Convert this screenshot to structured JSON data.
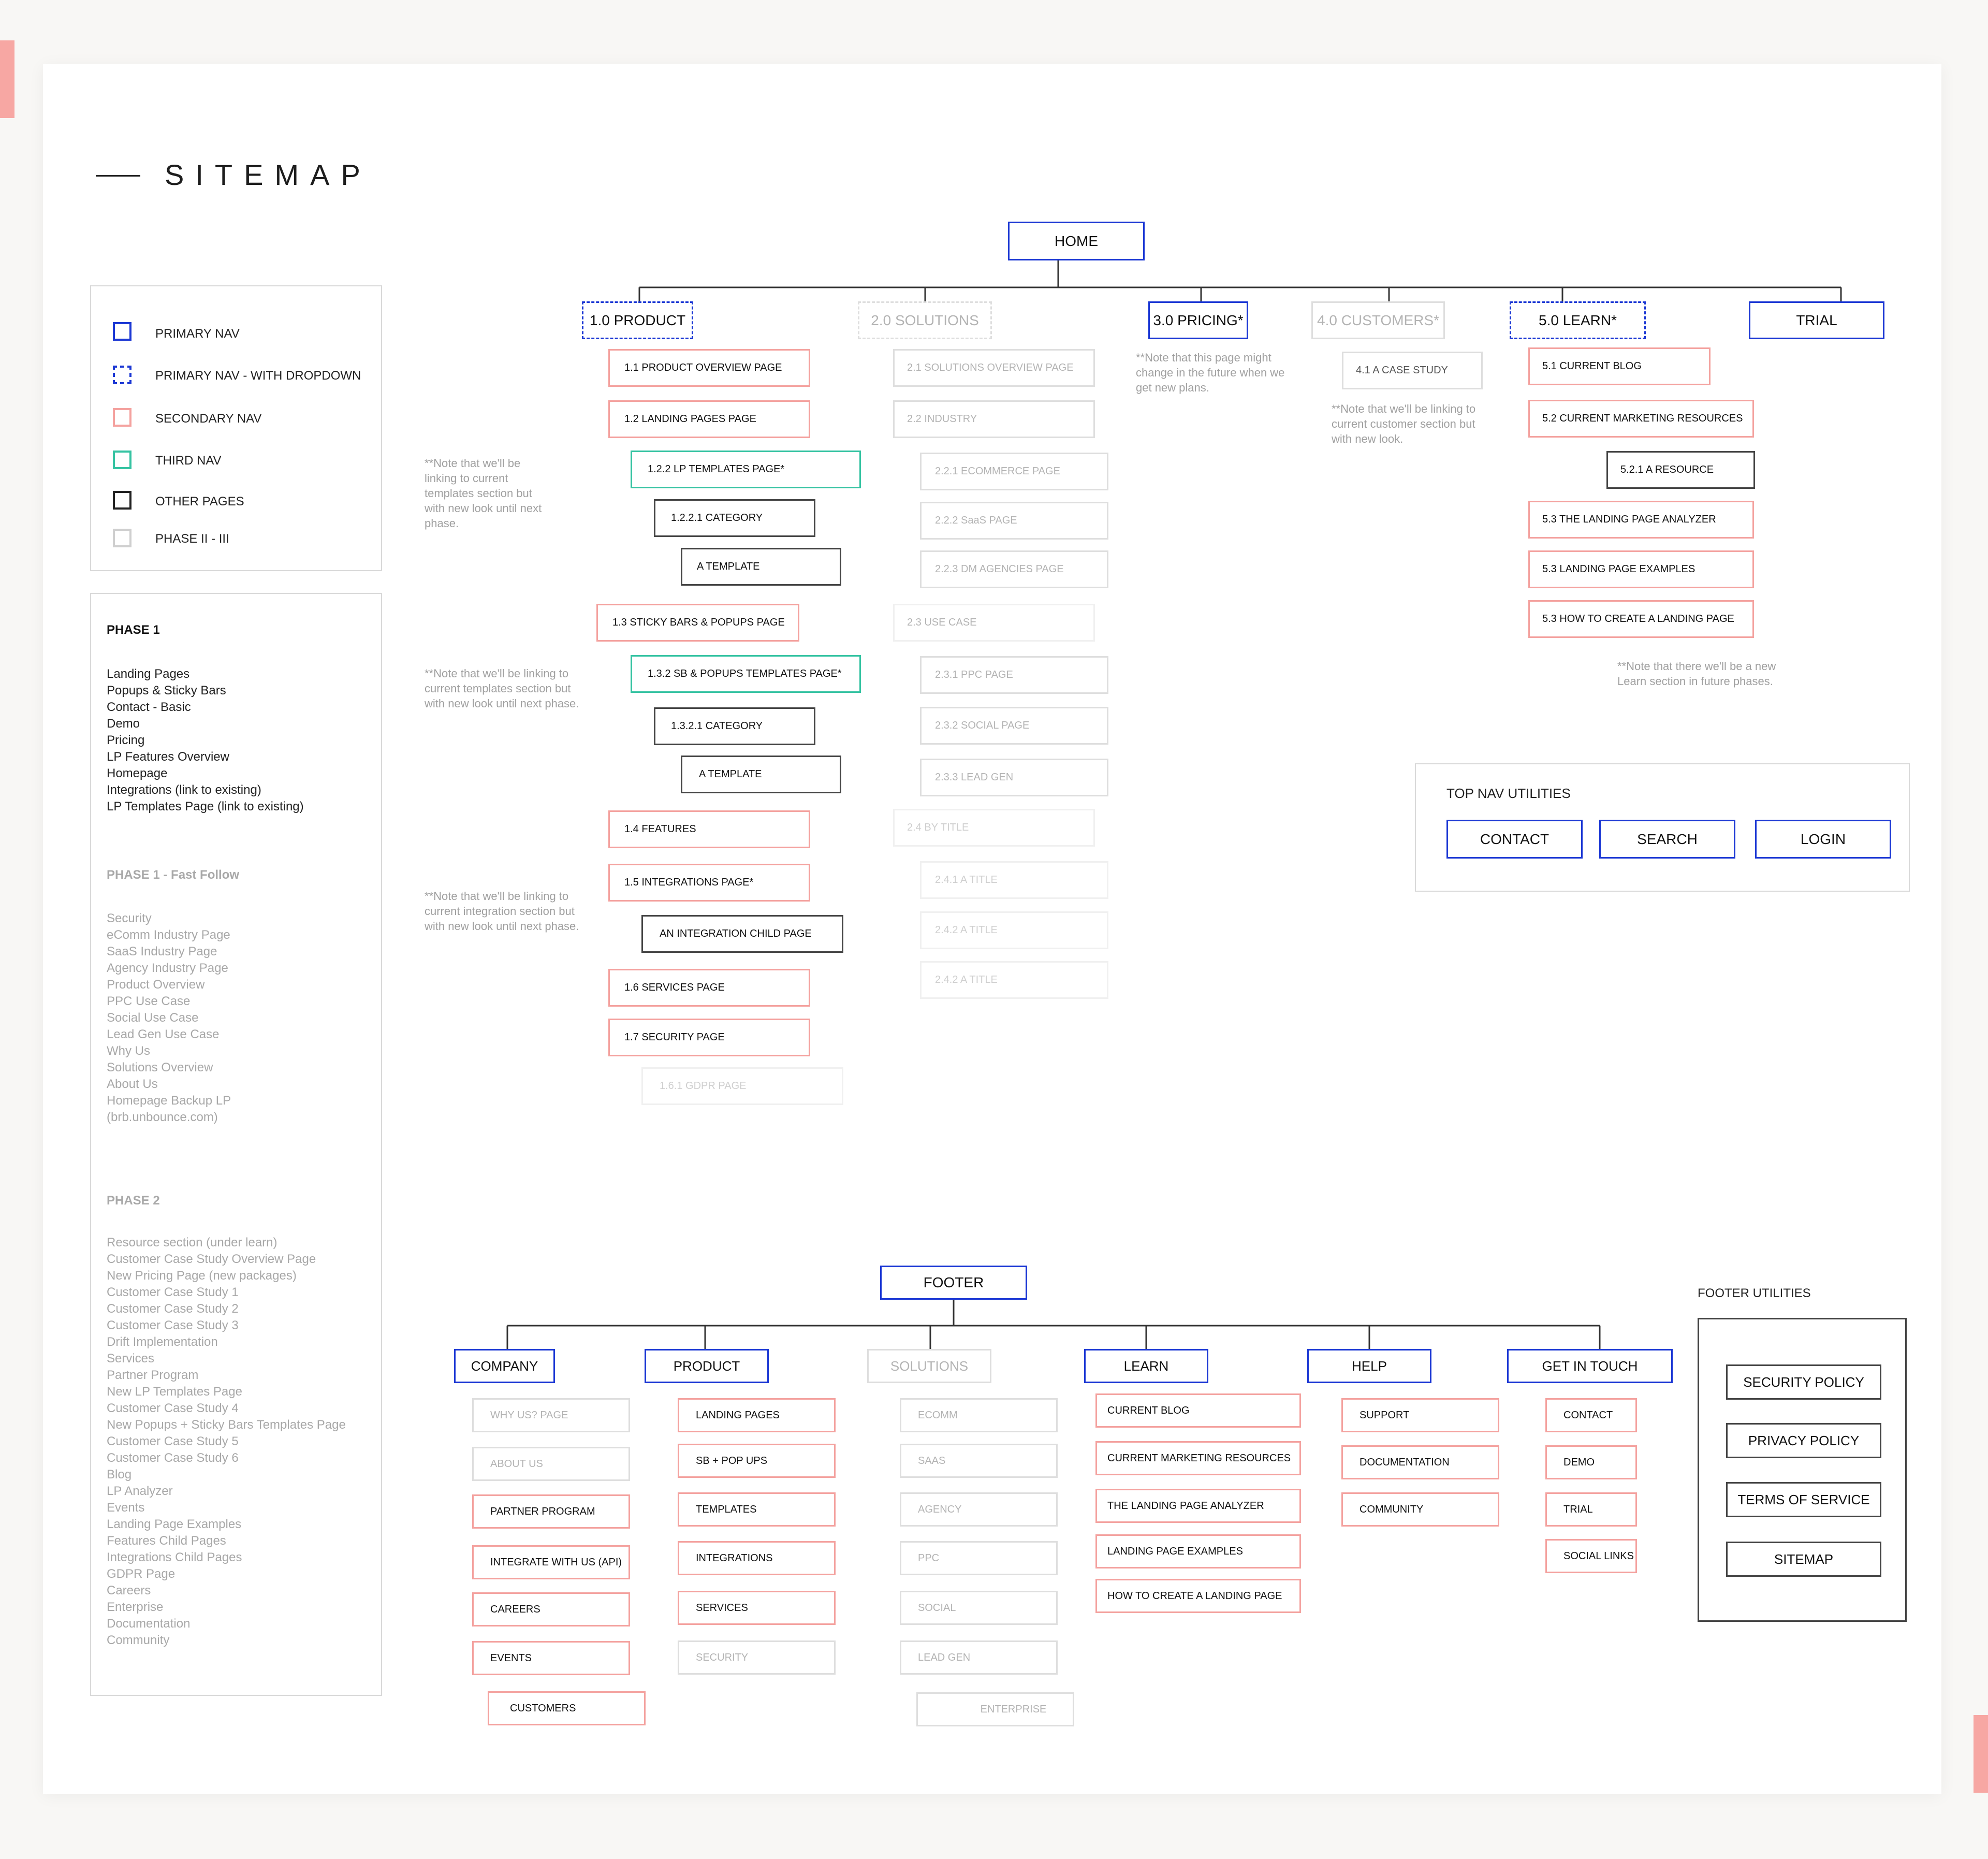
{
  "title": "SITEMAP",
  "legend": {
    "primary_nav": "PRIMARY NAV",
    "primary_nav_dropdown": "PRIMARY NAV - WITH DROPDOWN",
    "secondary_nav": "SECONDARY NAV",
    "third_nav": "THIRD NAV",
    "other_pages": "OTHER PAGES",
    "phase_2_3": "PHASE II - III"
  },
  "colors": {
    "primary": "#1c38d4",
    "secondary": "#f4a29f",
    "third": "#35c3a2",
    "other": "#444444",
    "phase": "#dedede"
  },
  "phases": {
    "phase1_title": "PHASE 1",
    "phase1_items": "Landing Pages\nPopups & Sticky Bars\nContact - Basic\nDemo\nPricing\nLP Features Overview\nHomepage\nIntegrations (link to existing)\nLP Templates Page (link to existing)",
    "phase1ff_title": "PHASE 1 - Fast Follow",
    "phase1ff_items": "Security\neComm Industry Page\nSaaS Industry Page\nAgency Industry Page\nProduct Overview\nPPC Use Case\nSocial Use Case\nLead Gen Use Case\nWhy Us\nSolutions Overview\nAbout Us\nHomepage Backup LP\n(brb.unbounce.com)",
    "phase2_title": "PHASE 2",
    "phase2_items": "Resource section (under learn)\nCustomer Case Study Overview Page\nNew Pricing Page (new packages)\nCustomer Case Study 1\nCustomer Case Study 2\nCustomer Case Study 3\nDrift Implementation\nServices\nPartner Program\nNew LP Templates Page\nCustomer Case Study 4\nNew Popups + Sticky Bars Templates Page\nCustomer Case Study 5\nCustomer Case Study 6\nBlog\nLP Analyzer\nEvents\nLanding Page Examples\nFeatures Child Pages\nIntegrations Child Pages\nGDPR Page\nCareers\nEnterprise\nDocumentation\nCommunity"
  },
  "top": {
    "home": "HOME",
    "nav": {
      "product": "1.0 PRODUCT",
      "solutions": "2.0 SOLUTIONS",
      "pricing": "3.0 PRICING*",
      "customers": "4.0 CUSTOMERS*",
      "learn": "5.0 LEARN*",
      "trial": "TRIAL"
    },
    "product": {
      "p1_1": "1.1  PRODUCT OVERVIEW PAGE",
      "p1_2": "1.2   LANDING PAGES PAGE",
      "p1_2_2": "1.2.2   LP TEMPLATES PAGE*",
      "p1_2_2_1": "1.2.2.1   CATEGORY",
      "p1_tmpl1": "A TEMPLATE",
      "p1_3": "1.3  STICKY BARS & POPUPS PAGE",
      "p1_3_2": "1.3.2   SB & POPUPS TEMPLATES PAGE*",
      "p1_3_2_1": "1.3.2.1   CATEGORY",
      "p1_tmpl2": "A TEMPLATE",
      "p1_4": "1.4  FEATURES",
      "p1_5": "1.5  INTEGRATIONS PAGE*",
      "p1_int_child": "AN INTEGRATION CHILD PAGE",
      "p1_6": "1.6 SERVICES PAGE",
      "p1_7": "1.7 SECURITY PAGE",
      "p1_6_1": "1.6.1 GDPR PAGE"
    },
    "solutions": {
      "s2_1": "2.1  SOLUTIONS OVERVIEW PAGE",
      "s2_2": "2.2  INDUSTRY",
      "s2_2_1": "2.2.1    ECOMMERCE PAGE",
      "s2_2_2": "2.2.2    SaaS PAGE",
      "s2_2_3": "2.2.3   DM AGENCIES PAGE",
      "s2_3": "2.3  USE CASE",
      "s2_3_1": "2.3.1    PPC PAGE",
      "s2_3_2": "2.3.2    SOCIAL PAGE",
      "s2_3_3": "2.3.3    LEAD GEN",
      "s2_4": "2.4  BY TITLE",
      "s2_4_1": "2.4.1    A TITLE",
      "s2_4_2a": "2.4.2    A TITLE",
      "s2_4_2b": "2.4.2    A TITLE"
    },
    "customers": {
      "c4_1": "4.1    A CASE STUDY"
    },
    "learn": {
      "l5_1": "5.1  CURRENT BLOG",
      "l5_2": "5.2  CURRENT MARKETING RESOURCES",
      "l5_2_1": "5.2.1   A RESOURCE",
      "l5_3a": "5.3 THE LANDING PAGE ANALYZER",
      "l5_3b": "5.3  LANDING PAGE EXAMPLES",
      "l5_3c": "5.3  HOW TO CREATE A LANDING PAGE"
    },
    "notes": {
      "templates": "**Note that we'll be\nlinking to current\ntemplates section but\nwith new look until next\nphase.",
      "templates2": "**Note that we'll be linking to\ncurrent templates section but\nwith new look until next phase.",
      "integration": "**Note that we'll be linking to\ncurrent integration section but\nwith new look until next phase.",
      "pricing": "**Note that this page might\nchange in the future when we\nget new plans.",
      "customers": "**Note that we'll be linking to\ncurrent customer section but\nwith new look.",
      "learn": "**Note that there we'll be a new\nLearn section in future phases."
    },
    "utilities": {
      "title": "TOP NAV UTILITIES",
      "contact": "CONTACT",
      "search": "SEARCH",
      "login": "LOGIN"
    }
  },
  "footer": {
    "root": "FOOTER",
    "company": {
      "label": "COMPANY",
      "items": [
        "WHY US? PAGE",
        "ABOUT US",
        "PARTNER PROGRAM",
        "INTEGRATE WITH US (API)",
        "CAREERS",
        "EVENTS",
        "CUSTOMERS"
      ]
    },
    "product": {
      "label": "PRODUCT",
      "items": [
        "LANDING PAGES",
        "SB + POP UPS",
        "TEMPLATES",
        "INTEGRATIONS",
        "SERVICES",
        "SECURITY"
      ]
    },
    "solutions": {
      "label": "SOLUTIONS",
      "items": [
        "ECOMM",
        "SAAS",
        "AGENCY",
        "PPC",
        "SOCIAL",
        "LEAD GEN",
        "ENTERPRISE"
      ]
    },
    "learn": {
      "label": "LEARN",
      "items": [
        "CURRENT BLOG",
        "CURRENT MARKETING RESOURCES",
        "THE LANDING PAGE ANALYZER",
        "LANDING PAGE EXAMPLES",
        "HOW TO CREATE A LANDING PAGE"
      ]
    },
    "help": {
      "label": "HELP",
      "items": [
        "SUPPORT",
        "DOCUMENTATION",
        "COMMUNITY"
      ]
    },
    "get_in_touch": {
      "label": "GET IN TOUCH",
      "items": [
        "CONTACT",
        "DEMO",
        "TRIAL",
        "SOCIAL LINKS"
      ]
    },
    "utilities": {
      "title": "FOOTER UTILITIES",
      "items": [
        "SECURITY POLICY",
        "PRIVACY POLICY",
        "TERMS OF SERVICE",
        "SITEMAP"
      ]
    }
  }
}
